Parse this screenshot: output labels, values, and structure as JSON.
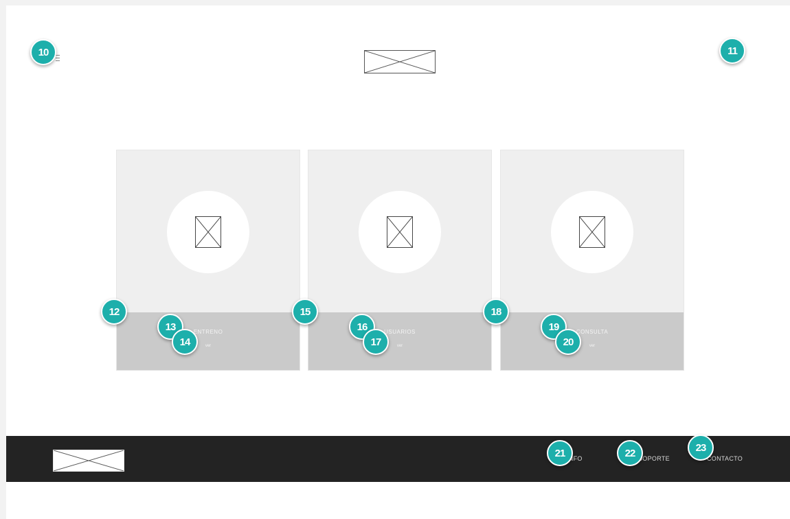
{
  "header": {
    "logo_icon": "image-placeholder-icon",
    "menu_icon": "menu-icon"
  },
  "cards": [
    {
      "title": "ENTRENO",
      "subtitle": "ver"
    },
    {
      "title": "USUARIOS",
      "subtitle": "ver"
    },
    {
      "title": "CONSULTA",
      "subtitle": "ver"
    }
  ],
  "footer": {
    "nav": [
      "INFO",
      "SOPORTE",
      "CONTACTO"
    ]
  },
  "annotations": [
    "10",
    "11",
    "12",
    "13",
    "14",
    "15",
    "16",
    "17",
    "18",
    "19",
    "20",
    "21",
    "22",
    "23"
  ],
  "colors": {
    "badge": "#1dafab",
    "footer": "#232323",
    "card": "#efefef",
    "card_band": "#cacaca"
  }
}
